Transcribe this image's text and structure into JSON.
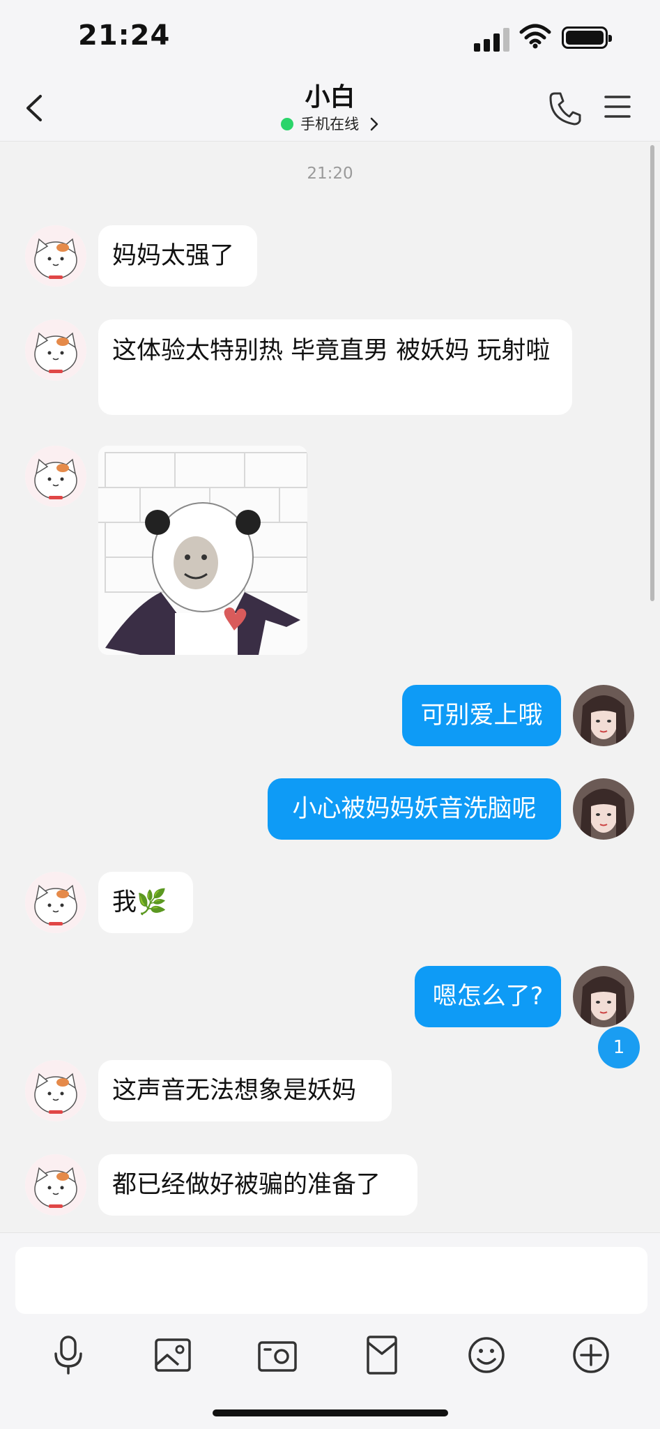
{
  "status_bar": {
    "time": "21:24"
  },
  "header": {
    "contact_name": "小白",
    "online_status": "手机在线",
    "back_icon": "chevron-left-icon",
    "call_icon": "phone-icon",
    "menu_icon": "hamburger-menu-icon"
  },
  "chat": {
    "timestamp": "21:20",
    "messages": [
      {
        "side": "left",
        "text": "妈妈太强了"
      },
      {
        "side": "left",
        "text": "这体验太特别热 毕竟直男 被妖妈 玩射啦"
      },
      {
        "side": "left",
        "type": "image",
        "description": "panda-meme-sticker"
      },
      {
        "side": "right",
        "text": "可别爱上哦"
      },
      {
        "side": "right",
        "text": "小心被妈妈妖音洗脑呢"
      },
      {
        "side": "left",
        "text": "我🌿"
      },
      {
        "side": "right",
        "text": "嗯怎么了?"
      },
      {
        "side": "left",
        "text": "这声音无法想象是妖妈"
      },
      {
        "side": "left",
        "text": "都已经做好被骗的准备了"
      }
    ],
    "unread_count": "1"
  },
  "input": {
    "placeholder": ""
  },
  "toolbar": {
    "icons": [
      "microphone-icon",
      "image-icon",
      "camera-icon",
      "red-packet-icon",
      "emoji-icon",
      "plus-icon"
    ]
  },
  "colors": {
    "accent": "#0e9bf6",
    "online": "#2bd46a",
    "background": "#f2f2f2"
  }
}
